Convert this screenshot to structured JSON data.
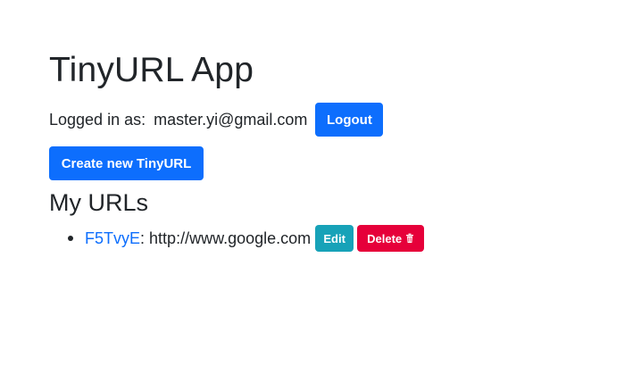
{
  "header": {
    "title": "TinyURL App"
  },
  "session": {
    "prefix": "Logged in as:",
    "email": "master.yi@gmail.com",
    "logout_label": "Logout"
  },
  "actions": {
    "create_label": "Create new TinyURL"
  },
  "urls_section": {
    "title": "My URLs",
    "items": [
      {
        "short_id": "F5TvyE",
        "separator": ":",
        "long_url": "http://www.google.com",
        "edit_label": "Edit",
        "delete_label": "Delete",
        "delete_icon": "trash-icon"
      }
    ]
  },
  "colors": {
    "primary": "#0d6efd",
    "edit": "#17a2b8",
    "delete": "#e6003a",
    "text": "#212529"
  }
}
